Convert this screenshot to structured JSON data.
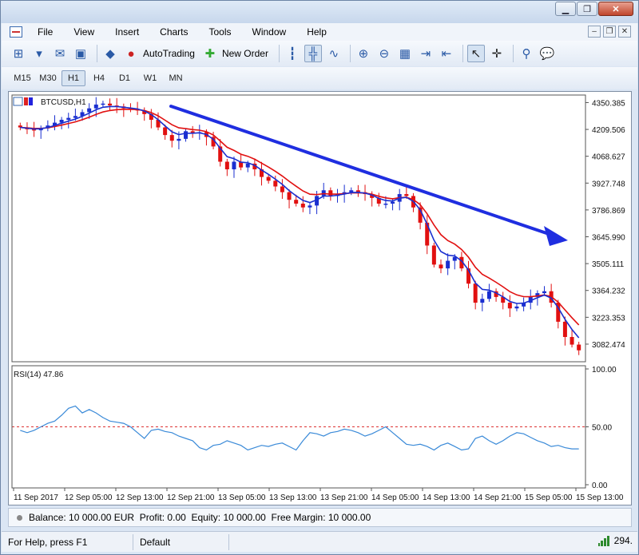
{
  "menu": [
    "File",
    "View",
    "Insert",
    "Charts",
    "Tools",
    "Window",
    "Help"
  ],
  "toolbar": {
    "autotrading_label": "AutoTrading",
    "new_order_label": "New Order"
  },
  "timeframes": [
    "M15",
    "M30",
    "H1",
    "H4",
    "D1",
    "W1",
    "MN"
  ],
  "active_timeframe": "H1",
  "chart": {
    "symbol_label": "BTCUSD,H1",
    "rsi_label": "RSI(14) 47.86",
    "price_ticks": [
      "4350.385",
      "4209.506",
      "4068.627",
      "3927.748",
      "3786.869",
      "3645.990",
      "3505.111",
      "3364.232",
      "3223.353",
      "3082.474"
    ],
    "rsi_ticks": [
      "100.00",
      "50.00",
      "0.00"
    ],
    "time_ticks": [
      "11 Sep 2017",
      "12 Sep 05:00",
      "12 Sep 13:00",
      "12 Sep 21:00",
      "13 Sep 05:00",
      "13 Sep 13:00",
      "13 Sep 21:00",
      "14 Sep 05:00",
      "14 Sep 13:00",
      "14 Sep 21:00",
      "15 Sep 05:00",
      "15 Sep 13:00"
    ],
    "colors": {
      "bull": "#1a2fd0",
      "bear": "#e11010",
      "ma_fast": "#1a2fd0",
      "ma_slow": "#e11010",
      "rsi": "#3a8ad8",
      "trend_arrow": "#1f2ee0"
    }
  },
  "chart_data": {
    "type": "candlestick",
    "symbol": "BTCUSD",
    "timeframe": "H1",
    "ylim": [
      2990,
      4390
    ],
    "close": [
      4220,
      4210,
      4205,
      4215,
      4230,
      4245,
      4260,
      4270,
      4280,
      4300,
      4320,
      4340,
      4345,
      4335,
      4330,
      4320,
      4315,
      4310,
      4290,
      4260,
      4220,
      4180,
      4150,
      4160,
      4200,
      4190,
      4195,
      4170,
      4120,
      4040,
      4000,
      4040,
      4010,
      4030,
      4000,
      3960,
      3940,
      3910,
      3880,
      3840,
      3820,
      3800,
      3810,
      3860,
      3890,
      3860,
      3870,
      3880,
      3890,
      3880,
      3870,
      3850,
      3820,
      3820,
      3830,
      3870,
      3860,
      3800,
      3720,
      3600,
      3500,
      3480,
      3520,
      3540,
      3480,
      3400,
      3300,
      3320,
      3360,
      3330,
      3300,
      3270,
      3280,
      3300,
      3330,
      3350,
      3360,
      3300,
      3200,
      3120,
      3080,
      3050
    ],
    "rsi": [
      47,
      45,
      47,
      50,
      53,
      55,
      60,
      66,
      68,
      62,
      65,
      62,
      58,
      55,
      54,
      53,
      50,
      45,
      40,
      47,
      48,
      46,
      45,
      42,
      40,
      38,
      32,
      30,
      34,
      35,
      38,
      36,
      34,
      30,
      32,
      34,
      33,
      35,
      36,
      33,
      30,
      38,
      45,
      44,
      42,
      45,
      46,
      48,
      47,
      45,
      42,
      44,
      47,
      50,
      45,
      40,
      35,
      34,
      35,
      33,
      30,
      34,
      36,
      33,
      30,
      31,
      40,
      42,
      38,
      35,
      38,
      42,
      45,
      44,
      41,
      38,
      36,
      33,
      34,
      32,
      31,
      31
    ],
    "rsi_ylim": [
      0,
      100
    ],
    "rsi_level": 50
  }
}
